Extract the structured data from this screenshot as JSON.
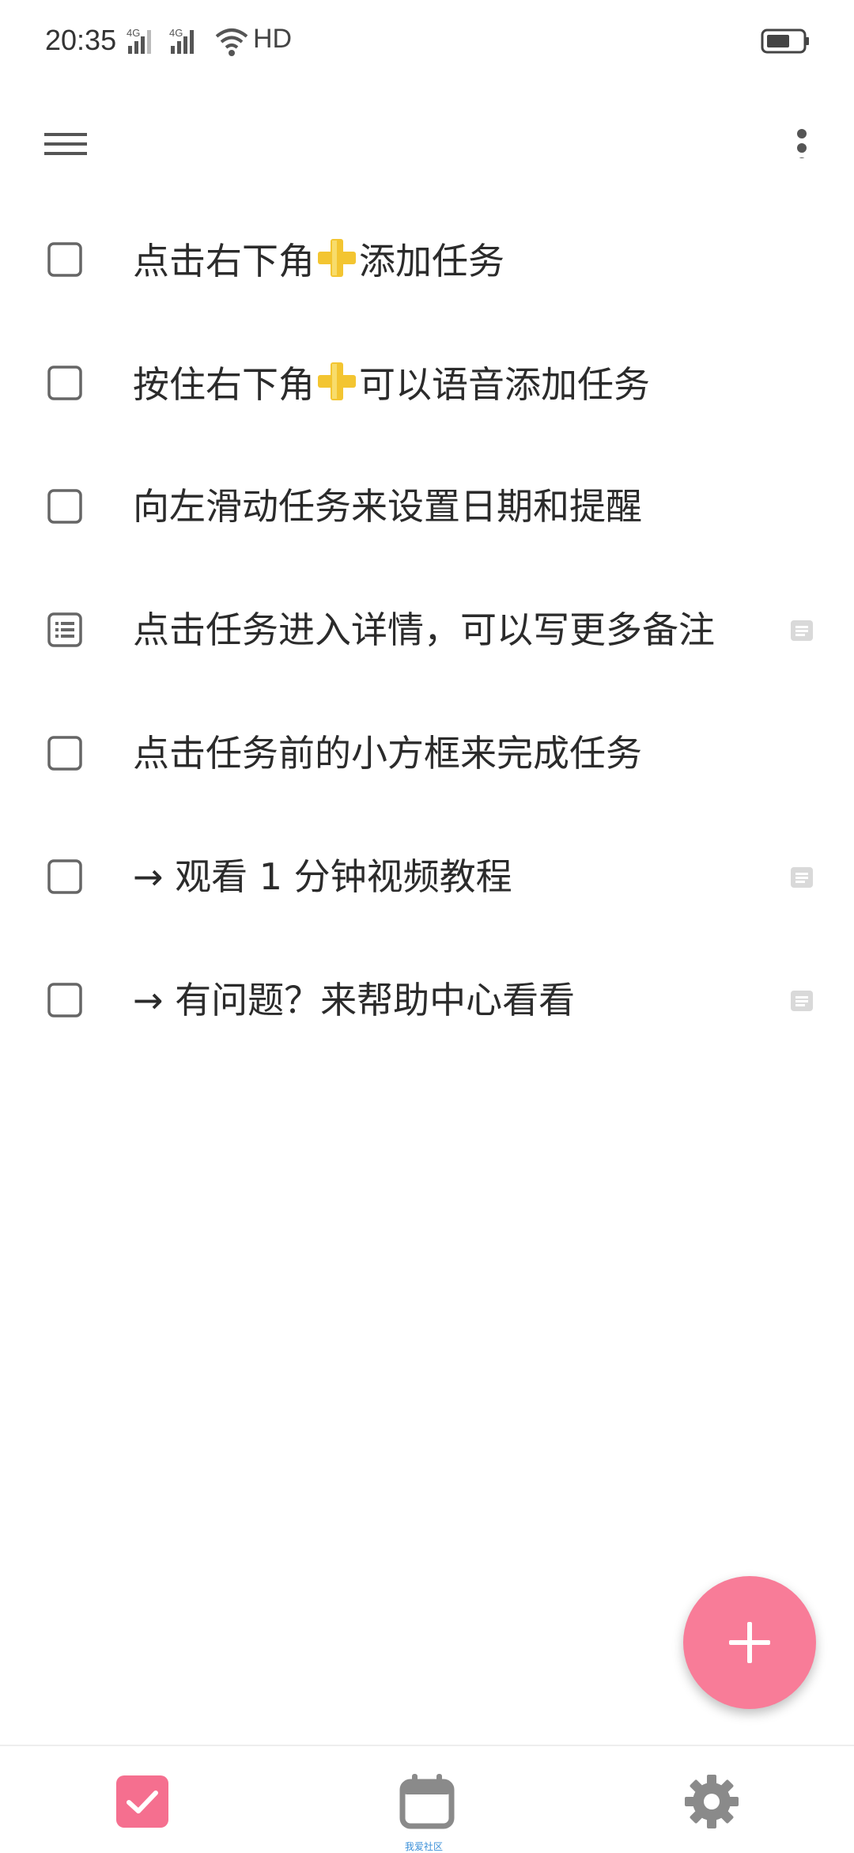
{
  "status_bar": {
    "time": "20:35",
    "net1": "4G",
    "net2": "4G",
    "hd": "HD"
  },
  "app_bar": {
    "menu_icon": "hamburger-menu-icon",
    "more_icon": "more-vertical-icon"
  },
  "tasks": [
    {
      "before": "点击右下角",
      "plus": true,
      "after": "添加任务",
      "has_note": false,
      "checkbox": "empty"
    },
    {
      "before": "按住右下角",
      "plus": true,
      "after": "可以语音添加任务",
      "has_note": false,
      "checkbox": "empty"
    },
    {
      "before": "向左滑动任务来设置日期和提醒",
      "plus": false,
      "after": "",
      "has_note": false,
      "checkbox": "empty"
    },
    {
      "before": "点击任务进入详情，可以写更多备注",
      "plus": false,
      "after": "",
      "has_note": true,
      "checkbox": "list"
    },
    {
      "before": "点击任务前的小方框来完成任务",
      "plus": false,
      "after": "",
      "has_note": false,
      "checkbox": "empty"
    },
    {
      "before": "→ 观看 1 分钟视频教程",
      "plus": false,
      "after": "",
      "has_note": true,
      "checkbox": "empty"
    },
    {
      "before": "→ 有问题？来帮助中心看看",
      "plus": false,
      "after": "",
      "has_note": true,
      "checkbox": "empty"
    }
  ],
  "fab": {
    "icon": "plus-icon",
    "color": "#f87c98"
  },
  "bottom_nav": {
    "tasks_icon": "checkbox-checked-icon",
    "calendar_icon": "calendar-icon",
    "settings_icon": "gear-icon",
    "caption": "我爱社区",
    "accent": "#f56f8f"
  }
}
